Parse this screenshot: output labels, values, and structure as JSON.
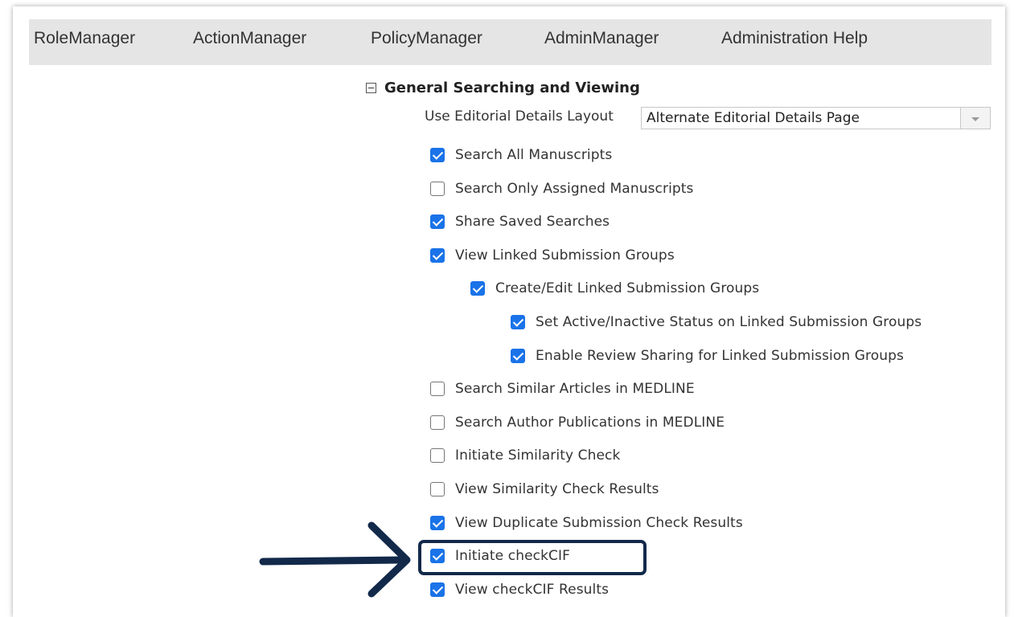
{
  "nav": {
    "items": [
      "RoleManager",
      "ActionManager",
      "PolicyManager",
      "AdminManager",
      "Administration Help"
    ]
  },
  "section": {
    "title": "General Searching and Viewing",
    "collapse_icon": "minus-box-icon"
  },
  "layout_field": {
    "label": "Use Editorial Details Layout",
    "value": "Alternate Editorial Details Page"
  },
  "options": [
    {
      "label": "Search All Manuscripts",
      "checked": true,
      "level": 0
    },
    {
      "label": "Search Only Assigned Manuscripts",
      "checked": false,
      "level": 0
    },
    {
      "label": "Share Saved Searches",
      "checked": true,
      "level": 0
    },
    {
      "label": "View Linked Submission Groups",
      "checked": true,
      "level": 0
    },
    {
      "label": "Create/Edit Linked Submission Groups",
      "checked": true,
      "level": 1
    },
    {
      "label": "Set Active/Inactive Status on Linked Submission Groups",
      "checked": true,
      "level": 2
    },
    {
      "label": "Enable Review Sharing for Linked Submission Groups",
      "checked": true,
      "level": 2
    },
    {
      "label": "Search Similar Articles in MEDLINE",
      "checked": false,
      "level": 0
    },
    {
      "label": "Search Author Publications in MEDLINE",
      "checked": false,
      "level": 0
    },
    {
      "label": "Initiate Similarity Check",
      "checked": false,
      "level": 0
    },
    {
      "label": "View Similarity Check Results",
      "checked": false,
      "level": 0
    },
    {
      "label": "View Duplicate Submission Check Results",
      "checked": true,
      "level": 0
    },
    {
      "label": "Initiate checkCIF",
      "checked": true,
      "level": 0,
      "highlighted": true
    },
    {
      "label": "View checkCIF Results",
      "checked": true,
      "level": 0
    }
  ],
  "colors": {
    "checkbox_checked": "#1a73e8",
    "menubar_bg": "#e5e5e5",
    "annotation": "#12294a"
  }
}
